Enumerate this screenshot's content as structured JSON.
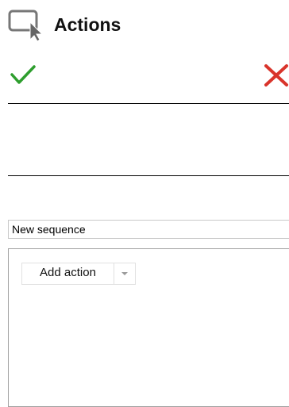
{
  "header": {
    "title": "Actions",
    "icon": "window-cursor-icon"
  },
  "toolbar": {
    "confirm_icon": "checkmark-icon",
    "cancel_icon": "close-icon",
    "confirm_color": "#2e9e2e",
    "cancel_color": "#d9342b"
  },
  "sequence": {
    "name_value": "New sequence"
  },
  "actions_panel": {
    "add_action_label": "Add action",
    "dropdown_icon": "chevron-down-icon"
  }
}
